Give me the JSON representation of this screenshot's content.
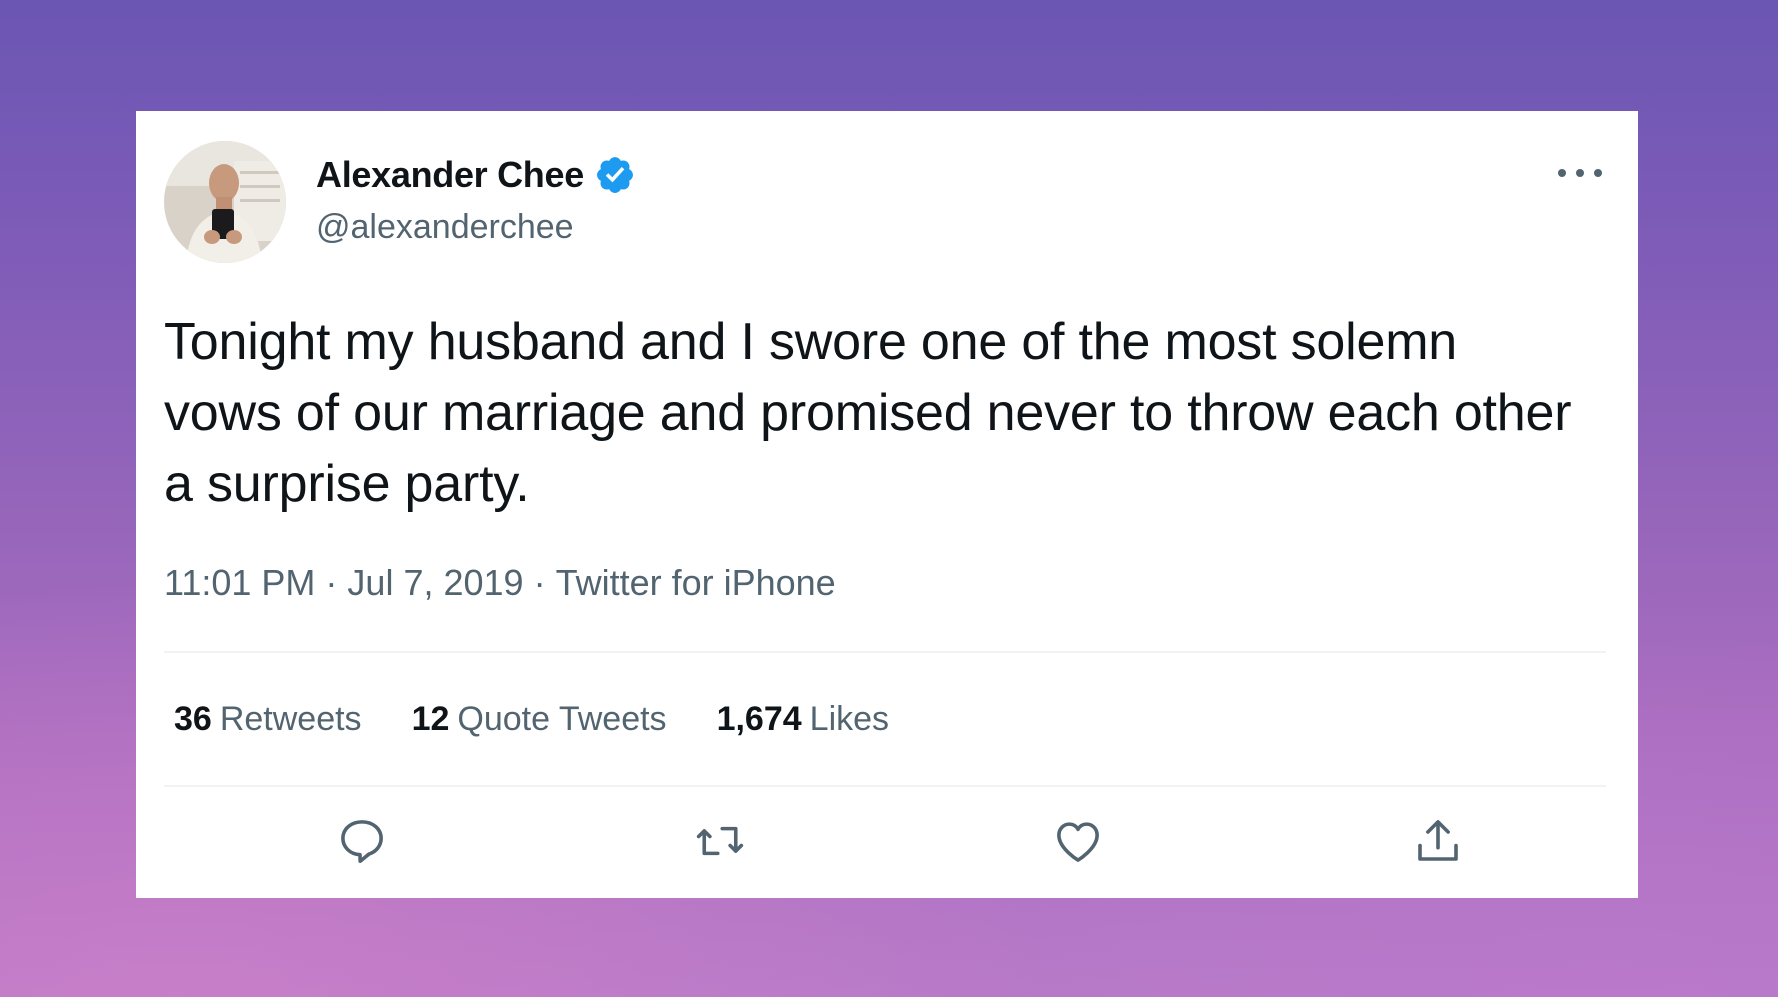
{
  "tweet": {
    "author": {
      "display_name": "Alexander Chee",
      "handle": "@alexanderchee",
      "verified": true
    },
    "text": "Tonight my husband and I swore one of the most solemn vows of our marriage and promised never to throw each other a surprise party.",
    "time": "11:01 PM",
    "date": "Jul 7, 2019",
    "source": "Twitter for iPhone",
    "separator": "·",
    "stats": {
      "retweets_count": "36",
      "retweets_label": "Retweets",
      "quotes_count": "12",
      "quotes_label": "Quote Tweets",
      "likes_count": "1,674",
      "likes_label": "Likes"
    },
    "actions": [
      "reply-icon",
      "retweet-icon",
      "like-icon",
      "share-icon"
    ]
  },
  "colors": {
    "text_primary": "#0f1419",
    "text_secondary": "#536471",
    "verified_blue": "#1d9bf0",
    "divider": "#eff3f4"
  }
}
